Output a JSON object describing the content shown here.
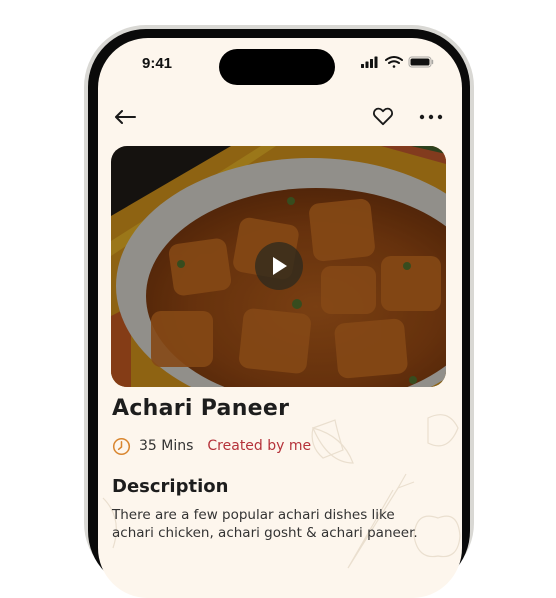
{
  "status_bar": {
    "time": "9:41",
    "icons": [
      "cellular-signal-icon",
      "wifi-icon",
      "battery-icon"
    ]
  },
  "nav": {
    "back_icon": "arrow-left-icon",
    "favorite_icon": "heart-icon",
    "more_icon": "more-horizontal-icon"
  },
  "recipe": {
    "title": "Achari Paneer",
    "duration": "35 Mins",
    "creator": "Created by me",
    "media_type": "video",
    "description_heading": "Description",
    "description": "There are a few popular achari dishes like achari chicken, achari gosht & achari paneer."
  },
  "colors": {
    "background": "#fdf6ed",
    "accent_red": "#b5323a",
    "clock_orange": "#d9862f",
    "text_dark": "#1d1d1d"
  }
}
